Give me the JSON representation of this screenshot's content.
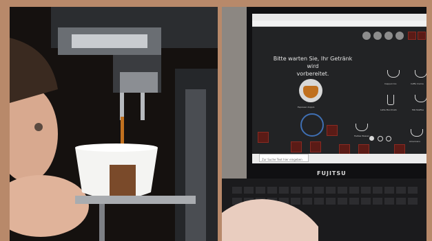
{
  "screen": {
    "wait_message_line1": "Bitte warten Sie, Ihr Getränk wird",
    "wait_message_line2": "vorbereitet.",
    "preparing_label": "Espresso doppio",
    "beverages": [
      "Cappuccino",
      "Latte Macchiato",
      "Caffè Crema",
      "Espresso",
      "Milchkaffee",
      "Café au lait",
      "Heißes Wasser",
      "Latte",
      "Americano"
    ],
    "search_placeholder": "Zur Suche Text hier eingeben"
  },
  "laptop": {
    "brand": "FUJITSU"
  },
  "colors": {
    "frame": "#b8896a",
    "screen_bg": "#222325",
    "accent_red": "#8a2a22",
    "crema": "#c0701f"
  }
}
